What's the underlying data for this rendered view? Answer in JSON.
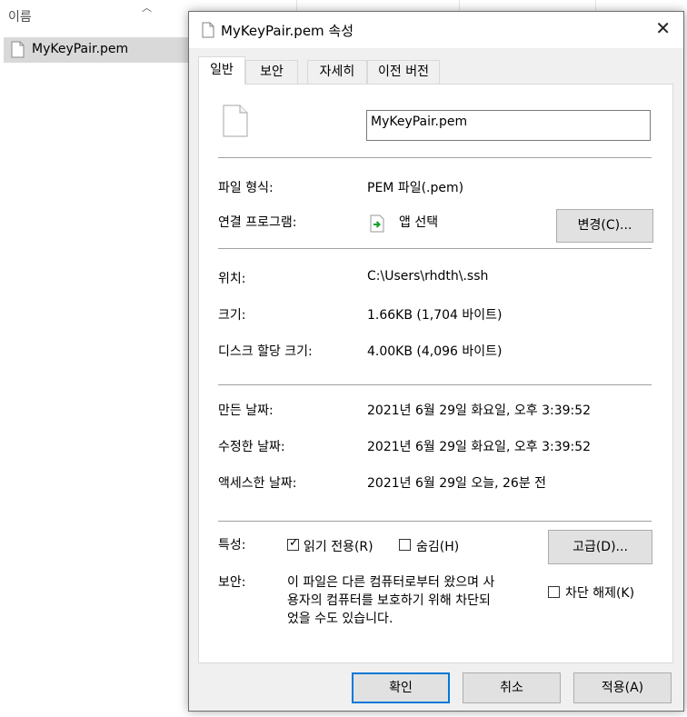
{
  "explorer": {
    "column_name": "이름",
    "selected_file": "MyKeyPair.pem"
  },
  "dialog": {
    "title": "MyKeyPair.pem 속성",
    "tabs": [
      {
        "label": "일반",
        "active": true
      },
      {
        "label": "보안",
        "active": false
      },
      {
        "label": "자세히",
        "active": false
      },
      {
        "label": "이전 버전",
        "active": false
      }
    ],
    "general": {
      "filename": "MyKeyPair.pem",
      "file_type_label": "파일 형식:",
      "file_type_value": "PEM 파일(.pem)",
      "opens_with_label": "연결 프로그램:",
      "opens_with_value": "앱 선택",
      "change_button": "변경(C)...",
      "location_label": "위치:",
      "location_value": "C:\\Users\\rhdth\\.ssh",
      "size_label": "크기:",
      "size_value": "1.66KB (1,704 바이트)",
      "size_on_disk_label": "디스크 할당 크기:",
      "size_on_disk_value": "4.00KB (4,096 바이트)",
      "created_label": "만든 날짜:",
      "created_value": "2021년 6월 29일 화요일, 오후 3:39:52",
      "modified_label": "수정한 날짜:",
      "modified_value": "2021년 6월 29일 화요일, 오후 3:39:52",
      "accessed_label": "액세스한 날짜:",
      "accessed_value": "2021년 6월 29일 오늘, 26분 전",
      "attributes_label": "특성:",
      "readonly_label": "읽기 전용(R)",
      "readonly_checked": true,
      "hidden_label": "숨김(H)",
      "hidden_checked": false,
      "advanced_button": "고급(D)...",
      "security_label": "보안:",
      "security_text_line1": "이 파일은 다른 컴퓨터로부터 왔으며 사",
      "security_text_line2": "용자의 컴퓨터를 보호하기 위해 차단되",
      "security_text_line3": "었을 수도 있습니다.",
      "unblock_label": "차단 해제(K)",
      "unblock_checked": false
    },
    "buttons": {
      "ok": "확인",
      "cancel": "취소",
      "apply": "적용(A)"
    },
    "colors": {
      "dialog_bg": "#f0f0f0",
      "panel_bg": "#ffffff",
      "primary_border": "#0078d7",
      "app_icon_green": "#1a9f2f"
    }
  }
}
